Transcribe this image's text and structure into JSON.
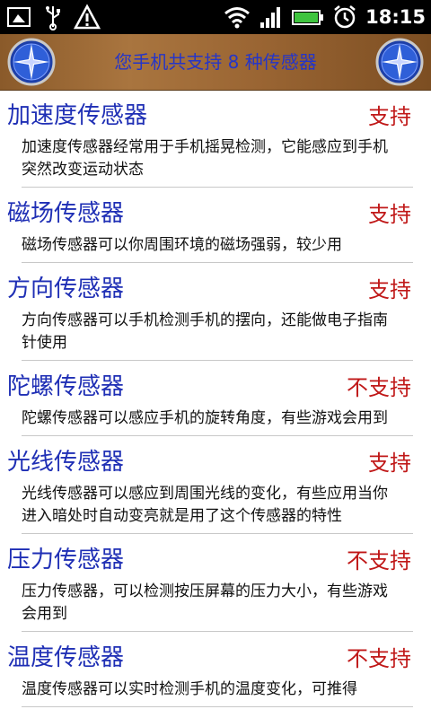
{
  "status_bar": {
    "time": "18:15",
    "icons": [
      "screenshot-icon",
      "usb-icon",
      "warning-icon",
      "wifi-icon",
      "signal-icon",
      "battery-icon",
      "alarm-icon"
    ]
  },
  "header": {
    "title": "您手机共支持 8 种传感器"
  },
  "colors": {
    "name": "#1f2fb5",
    "status": "#c01818",
    "header_title": "#2535c8"
  },
  "sensors": [
    {
      "name": "加速度传感器",
      "status": "支持",
      "desc": "加速度传感器经常用于手机摇晃检测，它能感应到手机突然改变运动状态"
    },
    {
      "name": "磁场传感器",
      "status": "支持",
      "desc": "磁场传感器可以你周围环境的磁场强弱，较少用"
    },
    {
      "name": "方向传感器",
      "status": "支持",
      "desc": "方向传感器可以手机检测手机的摆向，还能做电子指南针使用"
    },
    {
      "name": "陀螺传感器",
      "status": "不支持",
      "desc": "陀螺传感器可以感应手机的旋转角度，有些游戏会用到"
    },
    {
      "name": "光线传感器",
      "status": "支持",
      "desc": "光线传感器可以感应到周围光线的变化，有些应用当你进入暗处时自动变亮就是用了这个传感器的特性"
    },
    {
      "name": "压力传感器",
      "status": "不支持",
      "desc": "压力传感器，可以检测按压屏幕的压力大小，有些游戏会用到"
    },
    {
      "name": "温度传感器",
      "status": "不支持",
      "desc": "温度传感器可以实时检测手机的温度变化，可推得"
    }
  ]
}
